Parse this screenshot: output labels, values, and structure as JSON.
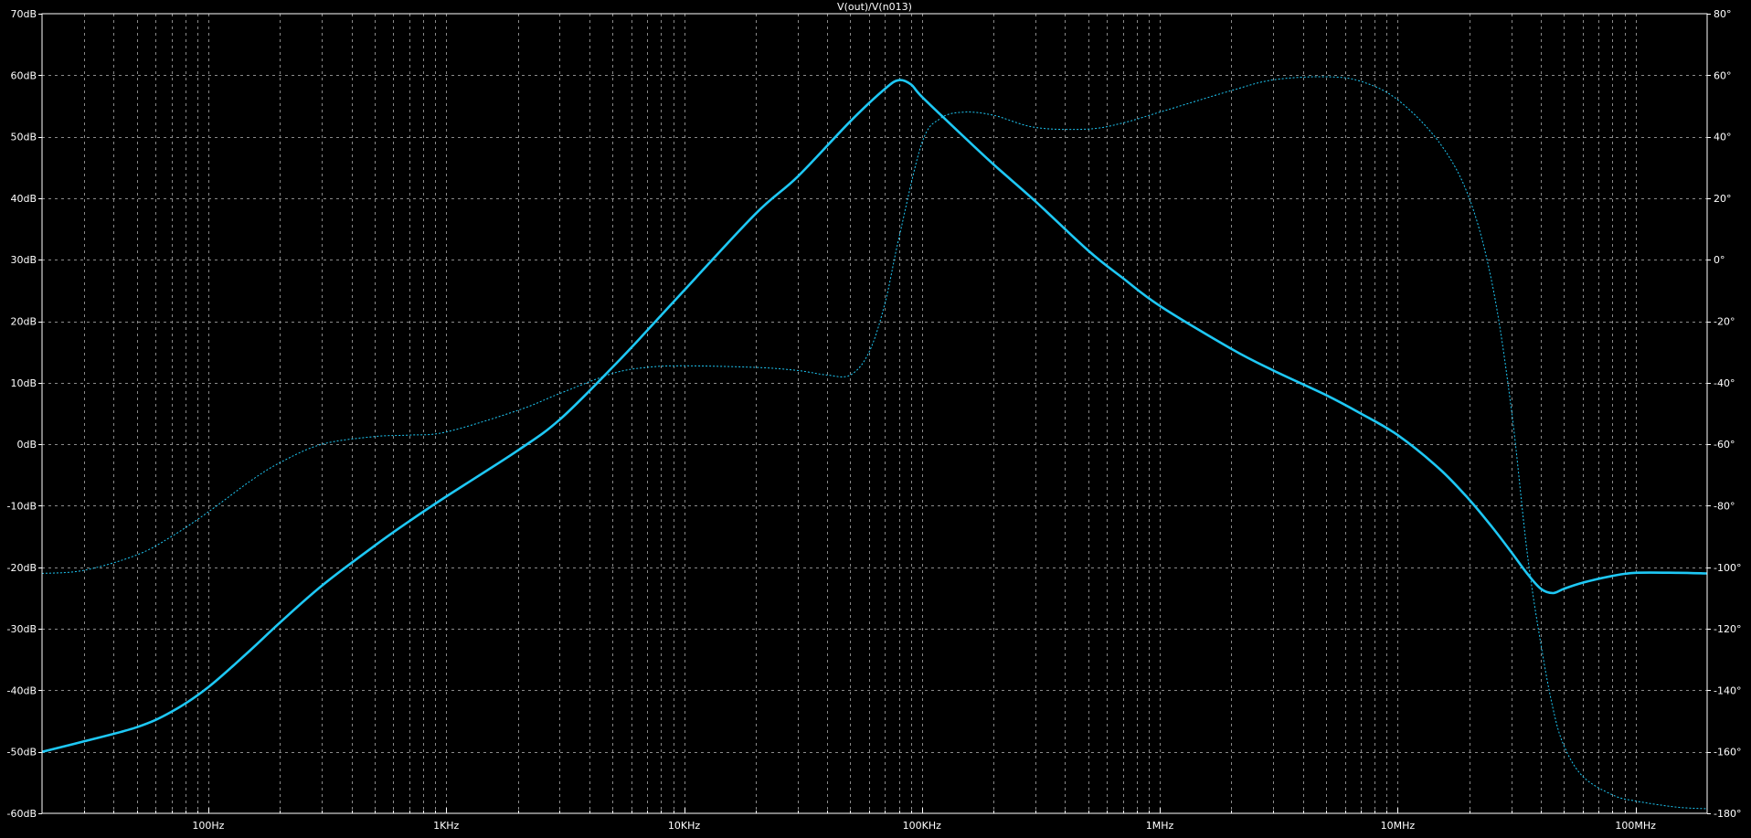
{
  "chart_data": {
    "type": "line",
    "title": "V(out)/V(n013)",
    "x_scale": "log",
    "x_range_hz": [
      20,
      200000000
    ],
    "x_tick_values": [
      100,
      1000,
      10000,
      100000,
      1000000,
      10000000,
      100000000
    ],
    "x_tick_labels": [
      "100Hz",
      "1KHz",
      "10KHz",
      "100KHz",
      "1MHz",
      "10MHz",
      "100MHz"
    ],
    "y_left_range_db": [
      -60,
      70
    ],
    "y_left_ticks": [
      -60,
      -50,
      -40,
      -30,
      -20,
      -10,
      0,
      10,
      20,
      30,
      40,
      50,
      60,
      70
    ],
    "y_left_tick_labels": [
      "-60dB",
      "-50dB",
      "-40dB",
      "-30dB",
      "-20dB",
      "-10dB",
      "0dB",
      "10dB",
      "20dB",
      "30dB",
      "40dB",
      "50dB",
      "60dB",
      "70dB"
    ],
    "y_right_range_deg": [
      -180,
      80
    ],
    "y_right_ticks": [
      -180,
      -160,
      -140,
      -120,
      -100,
      -80,
      -60,
      -40,
      -20,
      0,
      20,
      40,
      60,
      80
    ],
    "y_right_tick_labels": [
      "-180°",
      "-160°",
      "-140°",
      "-120°",
      "-100°",
      "-80°",
      "-60°",
      "-40°",
      "-20°",
      "0°",
      "20°",
      "40°",
      "60°",
      "80°"
    ],
    "grid": true,
    "colors": {
      "background": "#000000",
      "frame": "#ffffff",
      "grid": "#8a8a8a",
      "trace": "#1ec8f5"
    },
    "series": [
      {
        "axis": "left",
        "style": "solid",
        "x": [
          20,
          30,
          50,
          70,
          100,
          150,
          200,
          300,
          500,
          700,
          1000,
          2000,
          3000,
          5000,
          7000,
          10000,
          20000,
          30000,
          50000,
          70000,
          80000,
          90000,
          100000,
          150000,
          200000,
          300000,
          500000,
          700000,
          1000000,
          2000000,
          3000000,
          5000000,
          7000000,
          10000000,
          15000000,
          20000000,
          25000000,
          30000000,
          35000000,
          40000000,
          45000000,
          50000000,
          60000000,
          80000000,
          100000000,
          150000000,
          200000000
        ],
        "y": [
          -50,
          -48.3,
          -46,
          -43.5,
          -39.5,
          -33.5,
          -29,
          -23,
          -16.5,
          -12.5,
          -8.5,
          -1,
          4,
          12.5,
          18.5,
          25,
          37.5,
          43.5,
          52.5,
          57.8,
          59.2,
          58.5,
          56.5,
          50,
          45.5,
          39.5,
          31.5,
          27,
          22.5,
          15.5,
          12,
          8,
          5,
          1.5,
          -4,
          -9,
          -13.5,
          -17.5,
          -21,
          -23.5,
          -24.2,
          -23.5,
          -22.5,
          -21.4,
          -20.9,
          -20.9,
          -21
        ]
      },
      {
        "axis": "right",
        "style": "dotted",
        "x": [
          20,
          30,
          50,
          70,
          100,
          150,
          200,
          300,
          500,
          700,
          1000,
          2000,
          3000,
          5000,
          7000,
          10000,
          20000,
          30000,
          40000,
          50000,
          60000,
          70000,
          80000,
          100000,
          120000,
          150000,
          200000,
          300000,
          500000,
          700000,
          1000000,
          2000000,
          3000000,
          5000000,
          7000000,
          10000000,
          15000000,
          20000000,
          25000000,
          30000000,
          35000000,
          40000000,
          45000000,
          50000000,
          60000000,
          80000000,
          100000000,
          150000000,
          200000000
        ],
        "y": [
          -102,
          -101,
          -96,
          -90,
          -82,
          -72,
          -66,
          -60,
          -57.5,
          -57,
          -56,
          -49,
          -43.5,
          -37,
          -35,
          -34.5,
          -35,
          -36,
          -37.5,
          -37.5,
          -30,
          -14,
          7,
          38,
          46,
          48,
          47,
          43,
          42.5,
          44.5,
          48,
          55,
          58.5,
          59.5,
          58,
          52,
          38,
          20,
          -8,
          -48,
          -95,
          -125,
          -146,
          -158,
          -168,
          -174,
          -176,
          -178,
          -178.5
        ]
      }
    ]
  }
}
